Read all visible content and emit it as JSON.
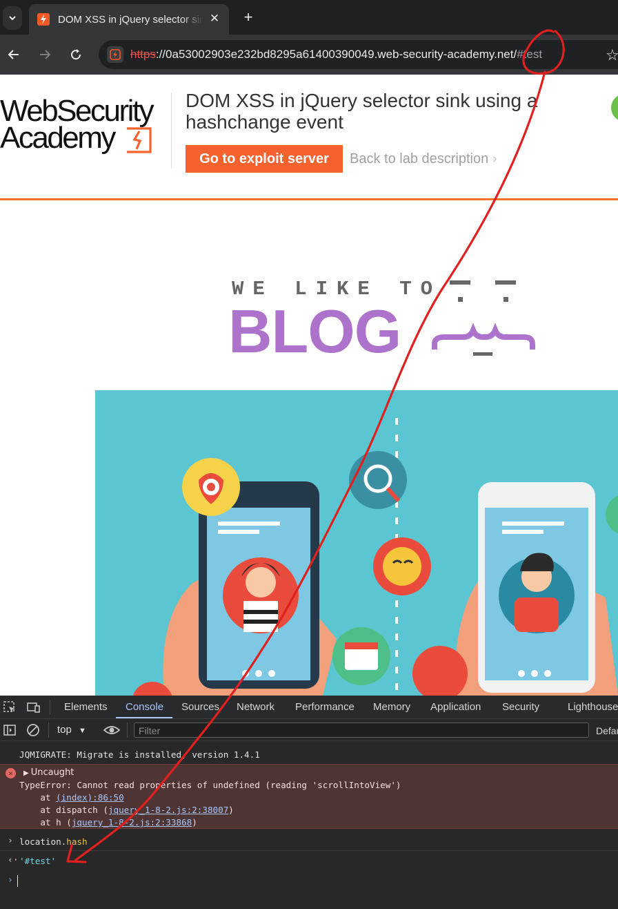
{
  "browser": {
    "tab_title": "DOM XSS in jQuery selector sink using a hashchange event",
    "url_scheme": "https",
    "url_rest": "://0a53002903e232bd8295a61400390049.web-security-academy.net/",
    "url_hash": "#test"
  },
  "lab": {
    "logo_line1": "WebSecurity",
    "logo_line2": "Academy",
    "title": "DOM XSS in jQuery selector sink using a hashchange event",
    "exploit_button": "Go to exploit server",
    "back_link": "Back to lab description"
  },
  "blog": {
    "tagline": "WE LIKE TO",
    "word": "BLOG"
  },
  "devtools": {
    "tabs": [
      "Elements",
      "Console",
      "Sources",
      "Network",
      "Performance",
      "Memory",
      "Application",
      "Security",
      "Lighthouse"
    ],
    "active_tab": "Console",
    "context": "top",
    "filter_placeholder": "Filter",
    "levels": "Default levels",
    "log_info": "JQMIGRATE: Migrate is installed, version 1.4.1",
    "error_title": "Uncaught",
    "error_message": "TypeError: Cannot read properties of undefined (reading 'scrollIntoView')",
    "stack": [
      {
        "prefix": "    at ",
        "link": "(index):86:50",
        "suffix": ""
      },
      {
        "prefix": "    at dispatch (",
        "link": "jquery_1-8-2.js:2:38007",
        "suffix": ")"
      },
      {
        "prefix": "    at h (",
        "link": "jquery_1-8-2.js:2:33868",
        "suffix": ")"
      }
    ],
    "command_object": "location.",
    "command_property": "hash",
    "result": "'#test'"
  },
  "colors": {
    "brand_orange": "#f6622d",
    "blog_purple": "#ad73cc",
    "hero_teal": "#5bc6d1",
    "annotation_red": "#e0201f"
  }
}
